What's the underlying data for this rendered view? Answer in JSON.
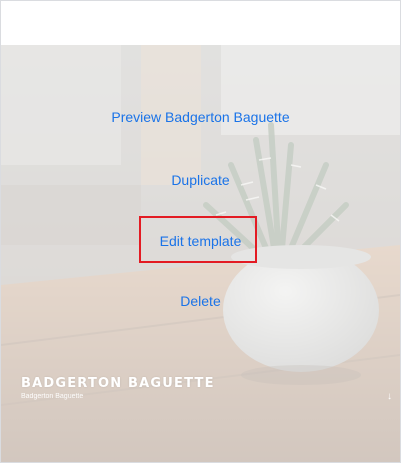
{
  "menu": {
    "preview_label": "Preview Badgerton Baguette",
    "duplicate_label": "Duplicate",
    "edit_template_label": "Edit template",
    "delete_label": "Delete"
  },
  "site": {
    "title": "BADGERTON BAGUETTE",
    "subtitle": "Badgerton Baguette"
  },
  "icons": {
    "scroll_arrow": "arrow-down-icon"
  },
  "colors": {
    "link": "#1a73e8",
    "highlight": "#e31b23"
  }
}
